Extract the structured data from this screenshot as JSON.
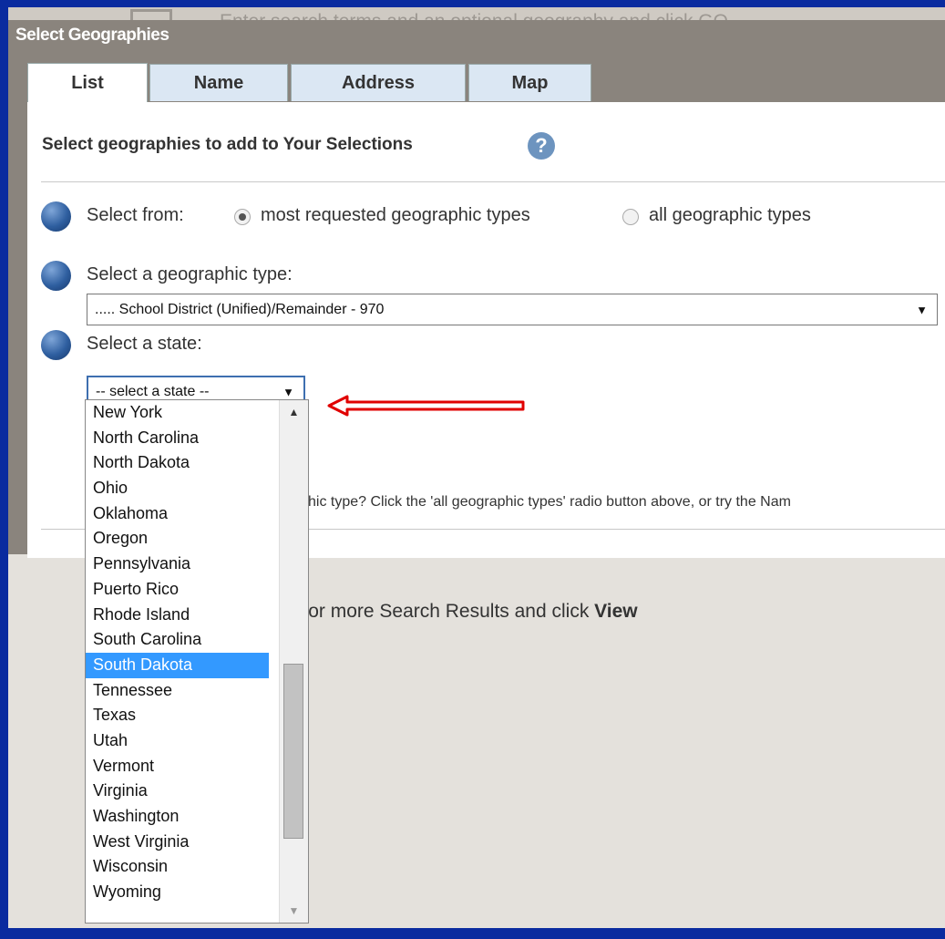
{
  "background": {
    "step_text": "Enter search terms and an optional geography and click GO",
    "results_prefix": "ne or more Search Results and click ",
    "results_bold": "View"
  },
  "dialog": {
    "title": "Select Geographies",
    "tabs": [
      "List",
      "Name",
      "Address",
      "Map"
    ],
    "active_tab": "List",
    "heading": "Select geographies to add to Your Selections",
    "help_icon": "question-circle-icon",
    "select_from": {
      "label": "Select from:",
      "options": [
        "most requested geographic types",
        "all geographic types"
      ],
      "selected": "most requested geographic types"
    },
    "geo_type": {
      "label": "Select a geographic type:",
      "value": "..... School District (Unified)/Remainder - 970"
    },
    "state": {
      "label": "Select a state:",
      "value": "-- select a state --",
      "options": [
        "New York",
        "North Carolina",
        "North Dakota",
        "Ohio",
        "Oklahoma",
        "Oregon",
        "Pennsylvania",
        "Puerto Rico",
        "Rhode Island",
        "South Carolina",
        "South Dakota",
        "Tennessee",
        "Texas",
        "Utah",
        "Vermont",
        "Virginia",
        "Washington",
        "West Virginia",
        "Wisconsin",
        "Wyoming"
      ],
      "highlighted": "South Dakota",
      "scroll_fraction": 0.8
    },
    "hint_text": "hic type? Click the 'all geographic types' radio button above, or try the Nam"
  },
  "colors": {
    "border_blue": "#0a2b9f",
    "annotation_red": "#e00000",
    "highlight": "#3399ff"
  }
}
